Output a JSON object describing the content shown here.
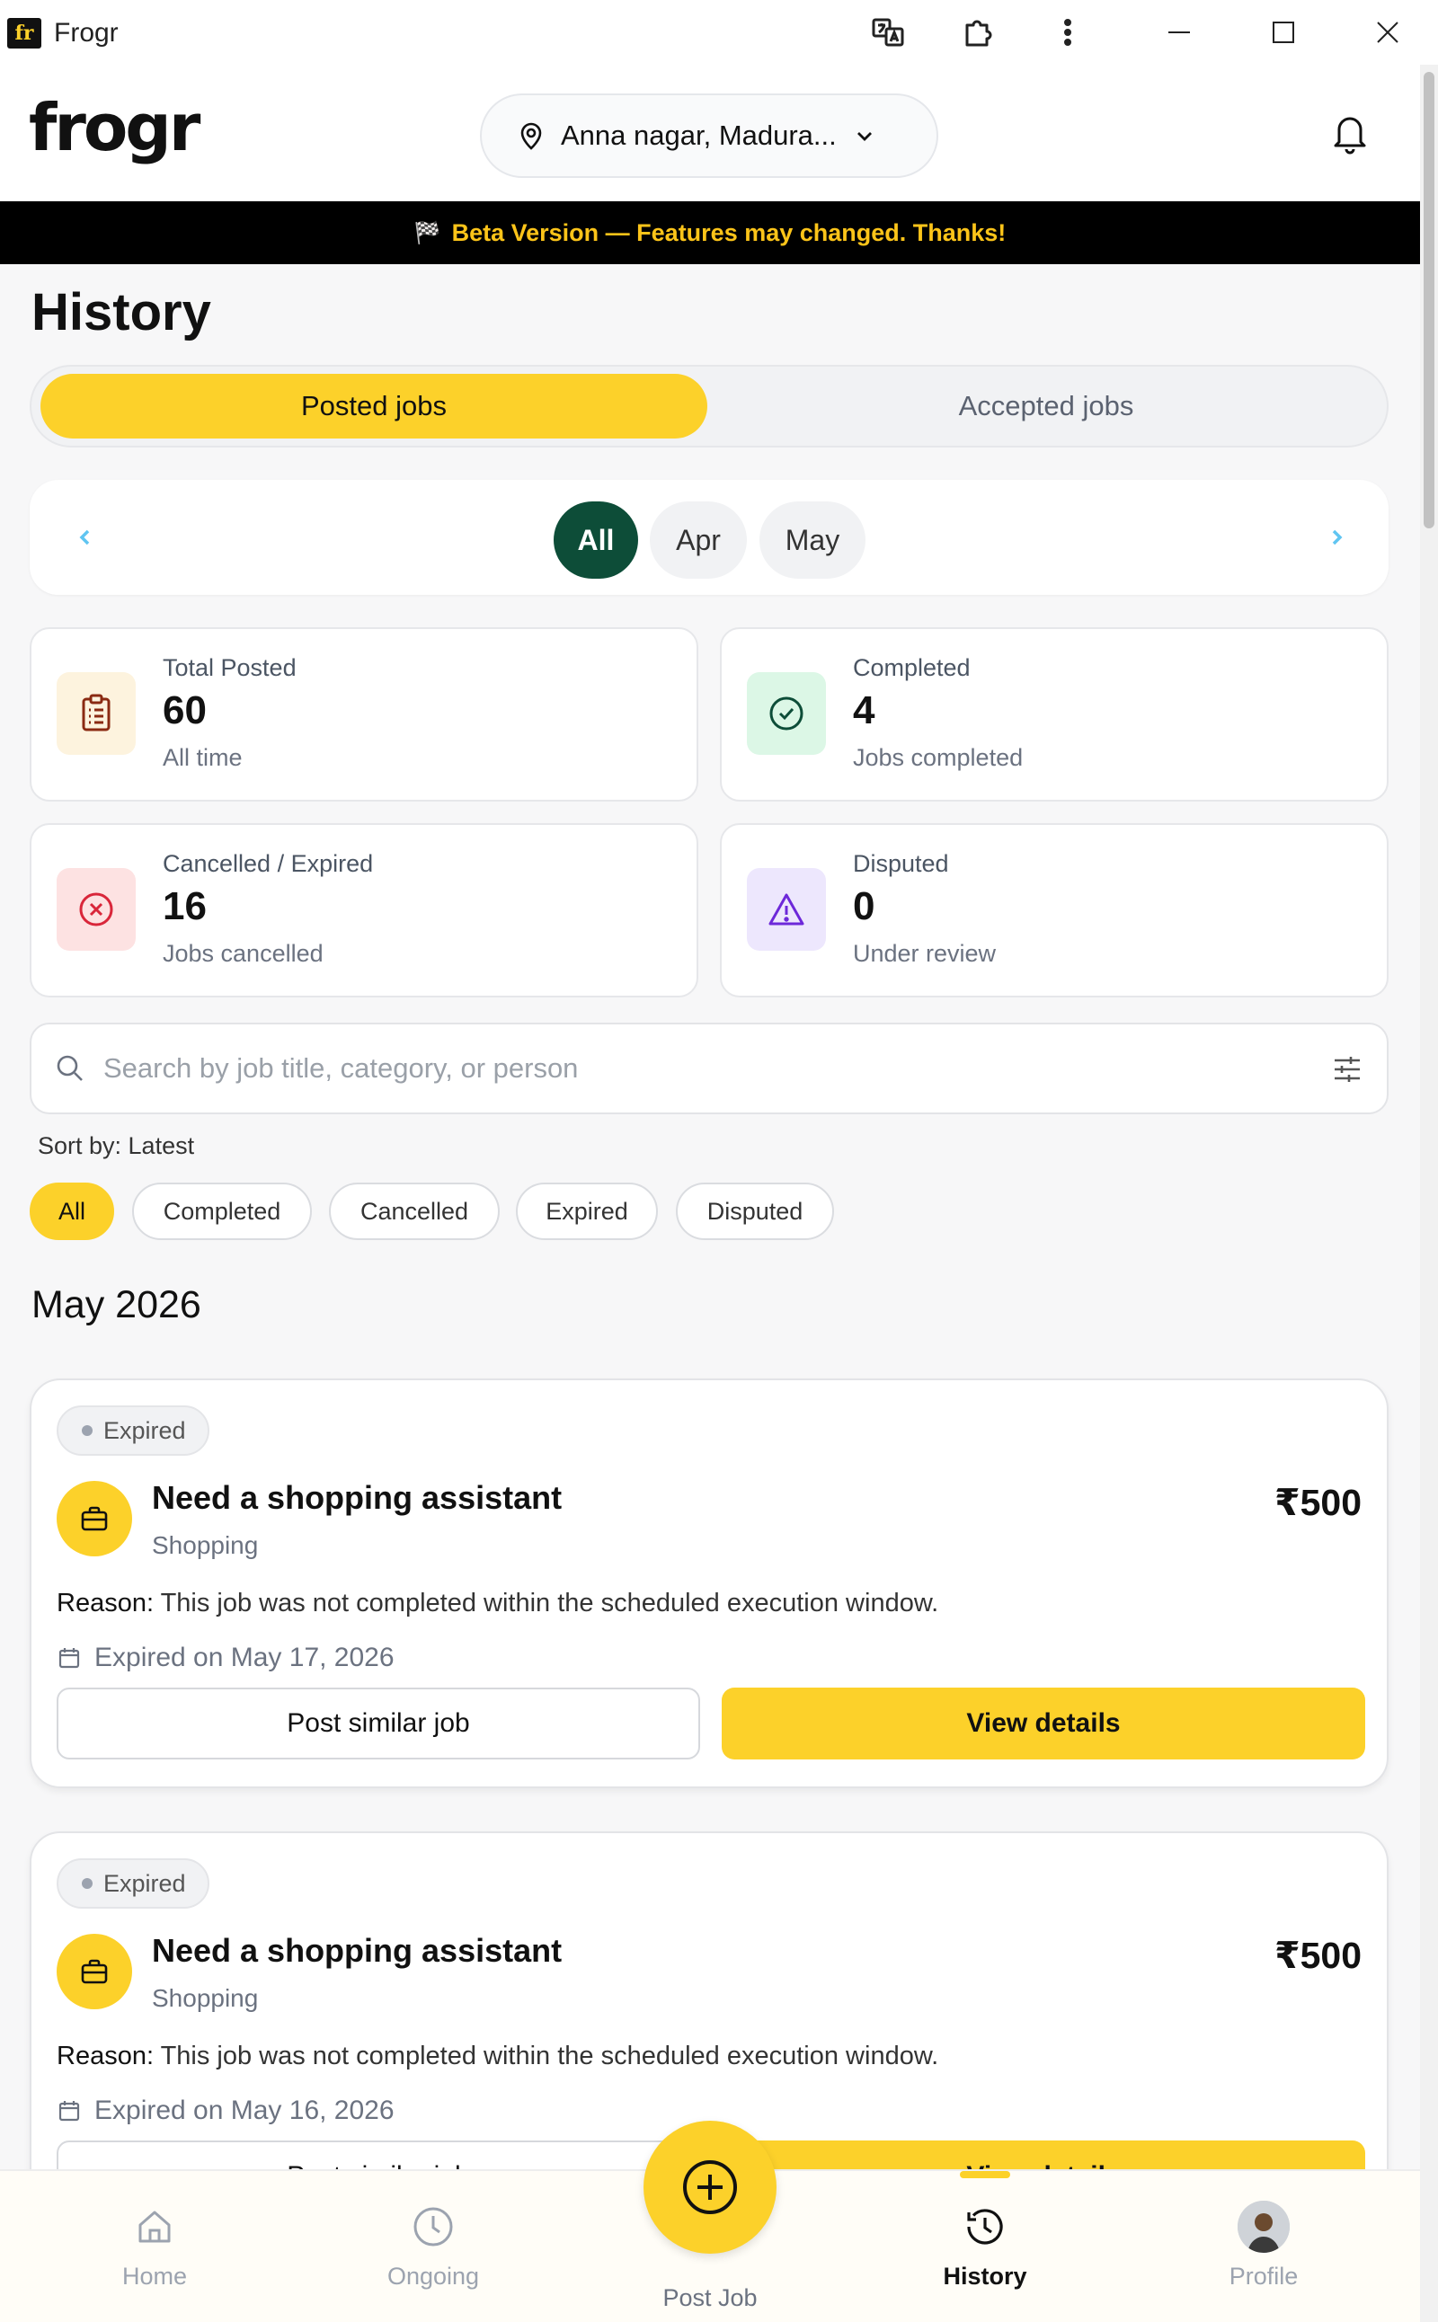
{
  "window": {
    "title": "Frogr",
    "icon_text": "fr"
  },
  "header": {
    "logo": "frogr",
    "location": "Anna nagar, Madura...",
    "icons": [
      "location-pin-icon",
      "chevron-down-icon",
      "bell-icon"
    ]
  },
  "banner": {
    "text": "Beta Version — Features may changed. Thanks!"
  },
  "page": {
    "title": "History"
  },
  "segments": {
    "posted": "Posted jobs",
    "accepted": "Accepted jobs",
    "active": "posted"
  },
  "months": {
    "items": [
      "All",
      "Apr",
      "May"
    ],
    "active": "All"
  },
  "stats": {
    "total": {
      "label": "Total Posted",
      "value": "60",
      "sub": "All time"
    },
    "completed": {
      "label": "Completed",
      "value": "4",
      "sub": "Jobs completed"
    },
    "cancelled": {
      "label": "Cancelled / Expired",
      "value": "16",
      "sub": "Jobs cancelled"
    },
    "disputed": {
      "label": "Disputed",
      "value": "0",
      "sub": "Under review"
    }
  },
  "search": {
    "placeholder": "Search by job title, category, or person",
    "value": ""
  },
  "sort": {
    "label": "Sort by: Latest"
  },
  "filters": [
    "All",
    "Completed",
    "Cancelled",
    "Expired",
    "Disputed"
  ],
  "month_group": "May 2026",
  "jobs": [
    {
      "status": "Expired",
      "title": "Need a shopping assistant",
      "category": "Shopping",
      "price": "₹500",
      "reason_label": "Reason:",
      "reason": "This job was not completed within the scheduled execution window.",
      "expiry": "Expired on May 17, 2026",
      "secondary_action": "Post similar job",
      "primary_action": "View details"
    },
    {
      "status": "Expired",
      "title": "Need a shopping assistant",
      "category": "Shopping",
      "price": "₹500",
      "reason_label": "Reason:",
      "reason": "This job was not completed within the scheduled execution window.",
      "expiry": "Expired on May 16, 2026",
      "secondary_action": "Post similar job",
      "primary_action": "View details"
    }
  ],
  "nav": {
    "home": "Home",
    "ongoing": "Ongoing",
    "post": "Post Job",
    "history": "History",
    "profile": "Profile",
    "active": "history"
  },
  "colors": {
    "accent": "#fcd12a",
    "dark_green": "#0d4d38",
    "banner_bg": "#000000"
  }
}
